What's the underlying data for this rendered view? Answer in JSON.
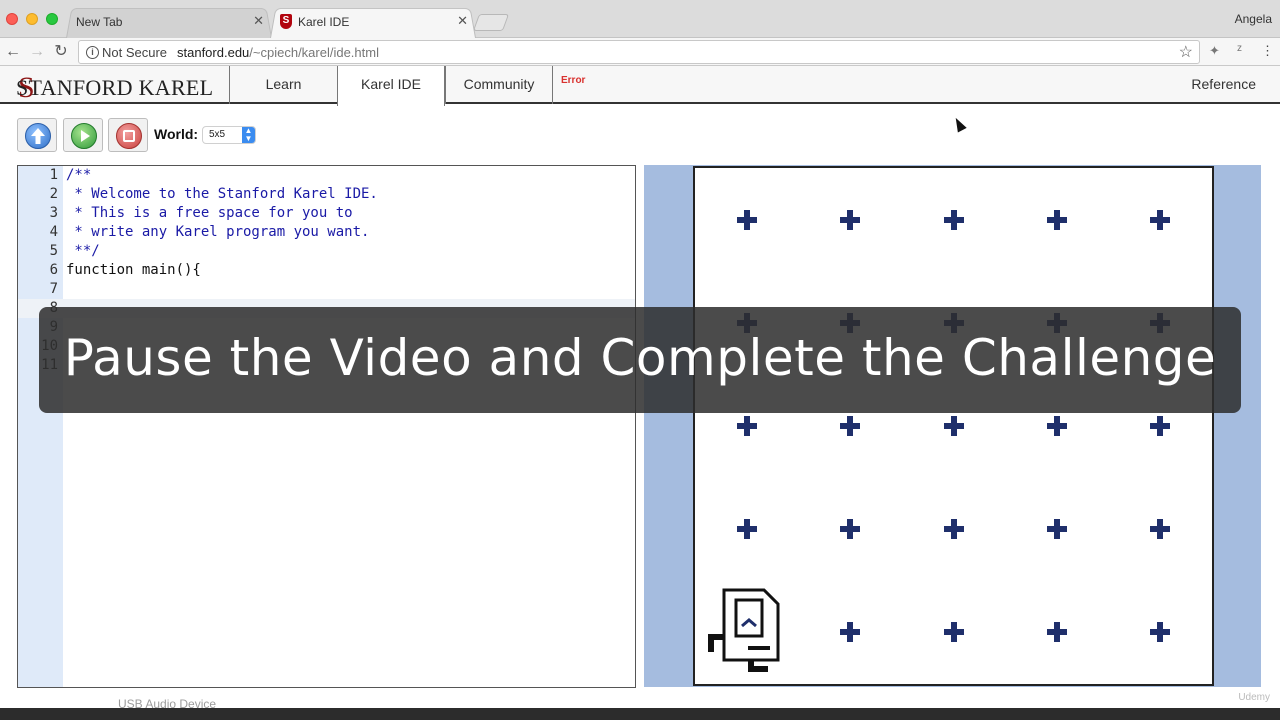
{
  "browser": {
    "tabs": [
      {
        "title": "New Tab",
        "active": false
      },
      {
        "title": "Karel IDE",
        "active": true
      }
    ],
    "profile": "Angela",
    "security": "Not Secure",
    "url_host": "stanford.edu",
    "url_path": "/~cpiech/karel/ide.html"
  },
  "site": {
    "logo": "STANFORD KAREL",
    "nav": [
      "Learn",
      "Karel IDE",
      "Community"
    ],
    "error_label": "Error",
    "reference": "Reference"
  },
  "toolbar": {
    "world_label": "World:",
    "world_value": "5x5",
    "colors": {
      "up": "#3b7fd6",
      "run": "#3aa346",
      "stop": "#d9534f"
    }
  },
  "editor": {
    "lines": [
      "/**",
      " * Welcome to the Stanford Karel IDE.",
      " * This is a free space for you to",
      " * write any Karel program you want.",
      " **/",
      "function main(){",
      "",
      "",
      "",
      "",
      ""
    ],
    "line_numbers": [
      "1",
      "2",
      "3",
      "4",
      "5",
      "6",
      "7",
      "8",
      "9",
      "10",
      "11"
    ]
  },
  "world": {
    "rows": 5,
    "cols": 5,
    "karel": {
      "row": 1,
      "col": 1,
      "facing": "east"
    }
  },
  "overlay": {
    "text": "Pause the Video and Complete the Challenge"
  },
  "dock": {
    "label": "USB Audio Device"
  },
  "watermark": "Udemy"
}
